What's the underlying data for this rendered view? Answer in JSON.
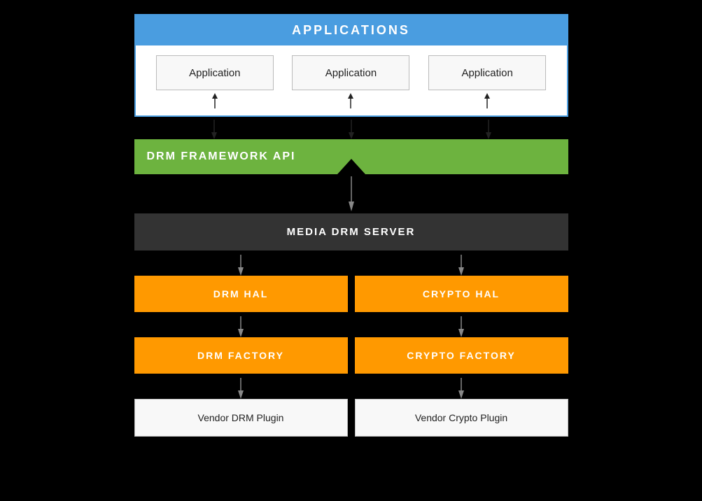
{
  "applications": {
    "header": "APPLICATIONS",
    "boxes": [
      "Application",
      "Application",
      "Application"
    ]
  },
  "drm_framework": {
    "label": "DRM FRAMEWORK API"
  },
  "media_drm_server": {
    "label": "MEDIA DRM SERVER"
  },
  "hal_row": {
    "left": "DRM HAL",
    "right": "CRYPTO HAL"
  },
  "factory_row": {
    "left": "DRM FACTORY",
    "right": "CRYPTO FACTORY"
  },
  "vendor_row": {
    "left": "Vendor DRM Plugin",
    "right": "Vendor Crypto Plugin"
  },
  "colors": {
    "blue": "#4a9de0",
    "green": "#6db33f",
    "orange": "#f90",
    "dark": "#333"
  }
}
